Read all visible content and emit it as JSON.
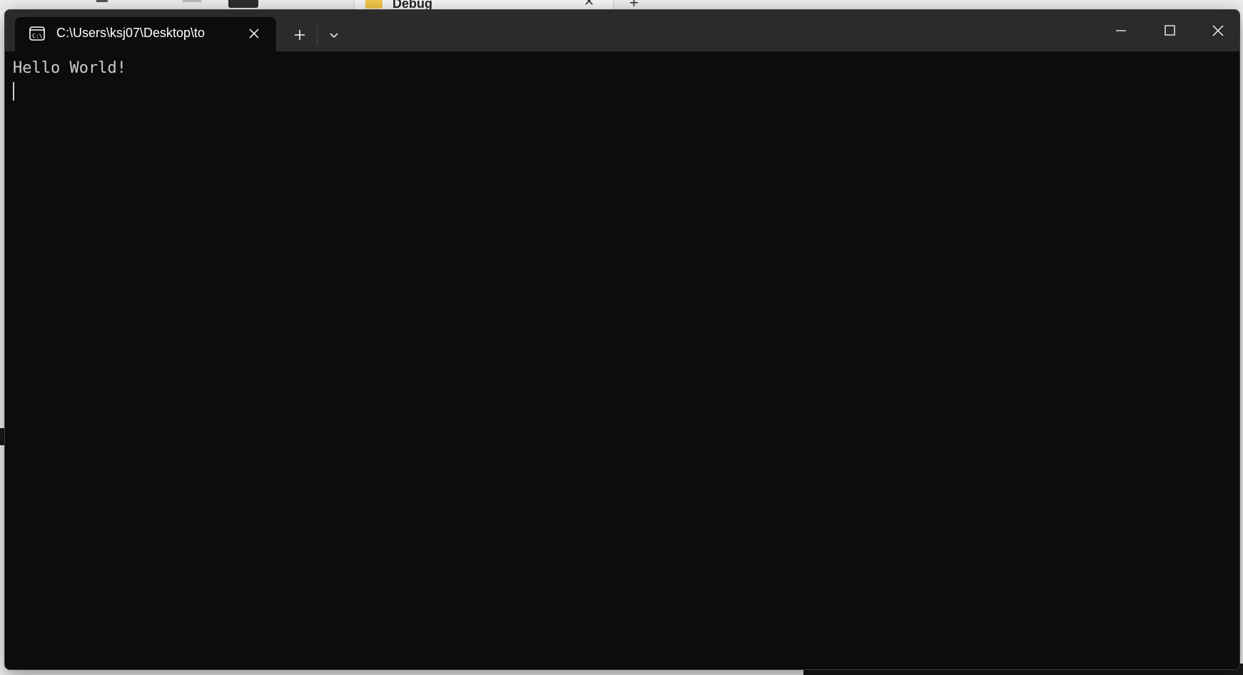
{
  "background": {
    "explorer_tab_label": "Debug",
    "explorer_tab_close": "✕",
    "explorer_new_tab": "+"
  },
  "window": {
    "tab": {
      "title": "C:\\Users\\ksj07\\Desktop\\to",
      "icon": "command-prompt-icon"
    },
    "titlebar_controls": {
      "new_tab_icon": "plus-icon",
      "dropdown_icon": "chevron-down-icon",
      "minimize_icon": "minimize-icon",
      "maximize_icon": "maximize-icon",
      "close_icon": "close-icon"
    },
    "terminal": {
      "lines": [
        "Hello World!"
      ]
    }
  },
  "colors": {
    "terminal_bg": "#0c0c0c",
    "titlebar_bg": "#2b2b2b",
    "text": "#cccccc"
  }
}
